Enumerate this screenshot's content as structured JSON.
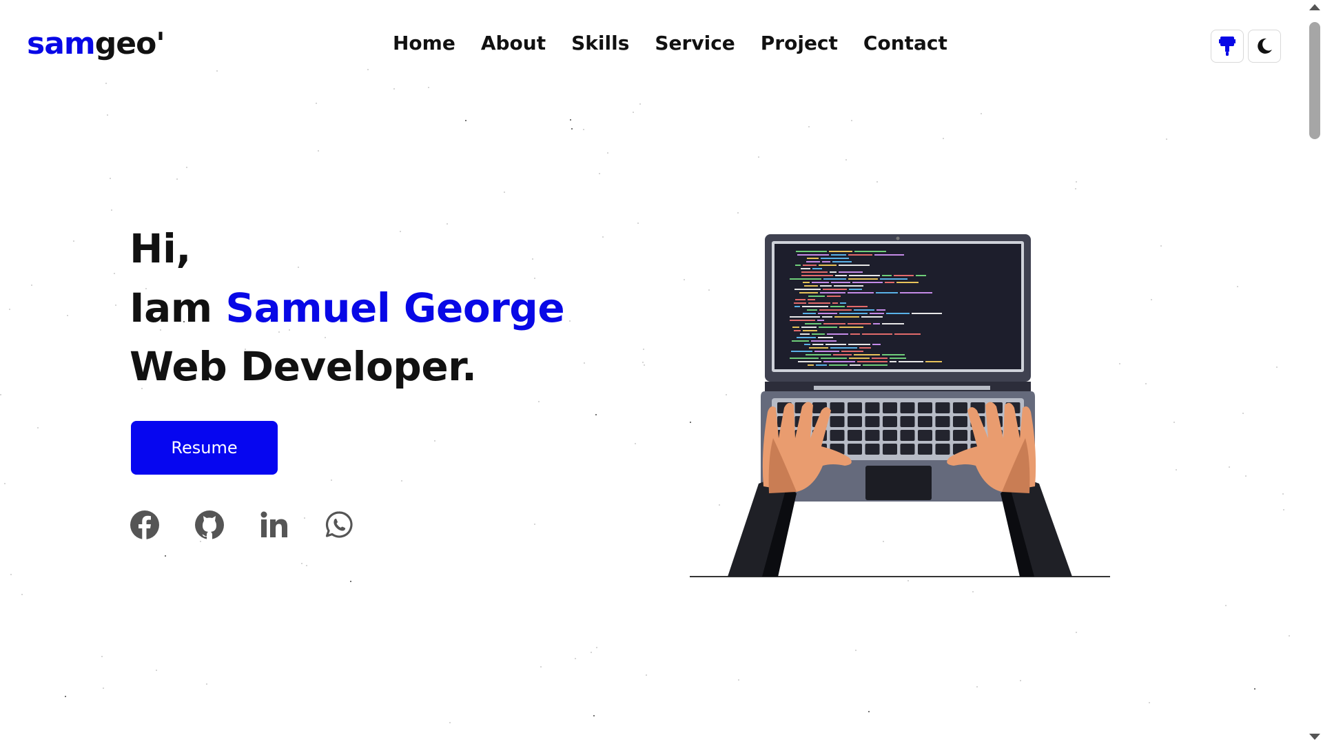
{
  "logo": {
    "accent": "sam",
    "rest": "geo'"
  },
  "nav": {
    "items": [
      {
        "label": "Home"
      },
      {
        "label": "About"
      },
      {
        "label": "Skills"
      },
      {
        "label": "Service"
      },
      {
        "label": "Project"
      },
      {
        "label": "Contact"
      }
    ]
  },
  "toolbar": {
    "paint_icon": "paint-roller-icon",
    "theme_icon": "moon-icon"
  },
  "hero": {
    "greeting": "Hi,",
    "intro_prefix": "Iam ",
    "name": "Samuel George",
    "role": "Web Developer.",
    "resume_label": "Resume"
  },
  "socials": [
    {
      "icon": "facebook-icon"
    },
    {
      "icon": "github-icon"
    },
    {
      "icon": "linkedin-icon"
    },
    {
      "icon": "whatsapp-icon"
    }
  ],
  "colors": {
    "accent": "#0808e6",
    "button": "#0606f0",
    "text": "#111111",
    "icon_gray": "#555555"
  }
}
